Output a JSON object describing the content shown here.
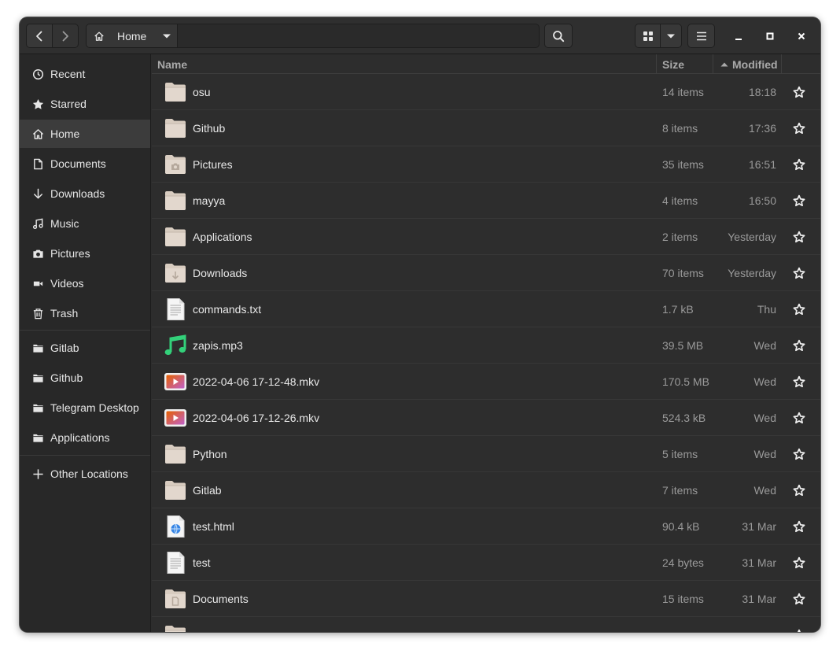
{
  "header": {
    "back_icon": "go-previous-icon",
    "forward_icon": "go-next-icon",
    "breadcrumb": {
      "icon": "home-icon",
      "label": "Home",
      "dropdown_icon": "pan-down-icon"
    },
    "search_icon": "search-icon",
    "view_icon": "grid-view-icon",
    "view_options_icon": "pan-down-icon",
    "menu_icon": "hamburger-menu-icon",
    "window_controls": [
      "minimize-icon",
      "maximize-icon",
      "close-icon"
    ]
  },
  "sidebar": {
    "places": [
      {
        "label": "Recent",
        "icon": "clock-icon"
      },
      {
        "label": "Starred",
        "icon": "star-icon"
      },
      {
        "label": "Home",
        "icon": "home-icon",
        "active": true
      },
      {
        "label": "Documents",
        "icon": "document-icon"
      },
      {
        "label": "Downloads",
        "icon": "download-icon"
      },
      {
        "label": "Music",
        "icon": "music-icon"
      },
      {
        "label": "Pictures",
        "icon": "camera-icon"
      },
      {
        "label": "Videos",
        "icon": "video-icon"
      },
      {
        "label": "Trash",
        "icon": "trash-icon"
      }
    ],
    "bookmarks": [
      {
        "label": "Gitlab",
        "icon": "folder-icon"
      },
      {
        "label": "Github",
        "icon": "folder-icon"
      },
      {
        "label": "Telegram Desktop",
        "icon": "folder-icon"
      },
      {
        "label": "Applications",
        "icon": "folder-icon"
      }
    ],
    "other_locations": {
      "label": "Other Locations",
      "icon": "plus-icon"
    }
  },
  "columns": {
    "name": "Name",
    "size": "Size",
    "modified": "Modified",
    "sort_icon": "sort-ascending-icon"
  },
  "files": [
    {
      "name": "osu",
      "size": "14 items",
      "modified": "18:18",
      "type": "folder"
    },
    {
      "name": "Github",
      "size": "8 items",
      "modified": "17:36",
      "type": "folder"
    },
    {
      "name": "Pictures",
      "size": "35 items",
      "modified": "16:51",
      "type": "folder-pictures"
    },
    {
      "name": "mayya",
      "size": "4 items",
      "modified": "16:50",
      "type": "folder"
    },
    {
      "name": "Applications",
      "size": "2 items",
      "modified": "Yesterday",
      "type": "folder"
    },
    {
      "name": "Downloads",
      "size": "70 items",
      "modified": "Yesterday",
      "type": "folder-download"
    },
    {
      "name": "commands.txt",
      "size": "1.7 kB",
      "modified": "Thu",
      "type": "text"
    },
    {
      "name": "zapis.mp3",
      "size": "39.5 MB",
      "modified": "Wed",
      "type": "audio"
    },
    {
      "name": "2022-04-06 17-12-48.mkv",
      "size": "170.5 MB",
      "modified": "Wed",
      "type": "video"
    },
    {
      "name": "2022-04-06 17-12-26.mkv",
      "size": "524.3 kB",
      "modified": "Wed",
      "type": "video"
    },
    {
      "name": "Python",
      "size": "5 items",
      "modified": "Wed",
      "type": "folder"
    },
    {
      "name": "Gitlab",
      "size": "7 items",
      "modified": "Wed",
      "type": "folder"
    },
    {
      "name": "test.html",
      "size": "90.4 kB",
      "modified": "31 Mar",
      "type": "html"
    },
    {
      "name": "test",
      "size": "24 bytes",
      "modified": "31 Mar",
      "type": "text"
    },
    {
      "name": "Documents",
      "size": "15 items",
      "modified": "31 Mar",
      "type": "folder-documents"
    },
    {
      "name": "",
      "size": "",
      "modified": "",
      "type": "folder"
    }
  ],
  "colors": {
    "window_bg": "#2d2d2d",
    "sidebar_bg": "#282828",
    "sidebar_active": "#3c3c3c",
    "folder": "#e0d5cb",
    "audio_accent": "#33d17a",
    "video_accent": "#e8603a"
  }
}
